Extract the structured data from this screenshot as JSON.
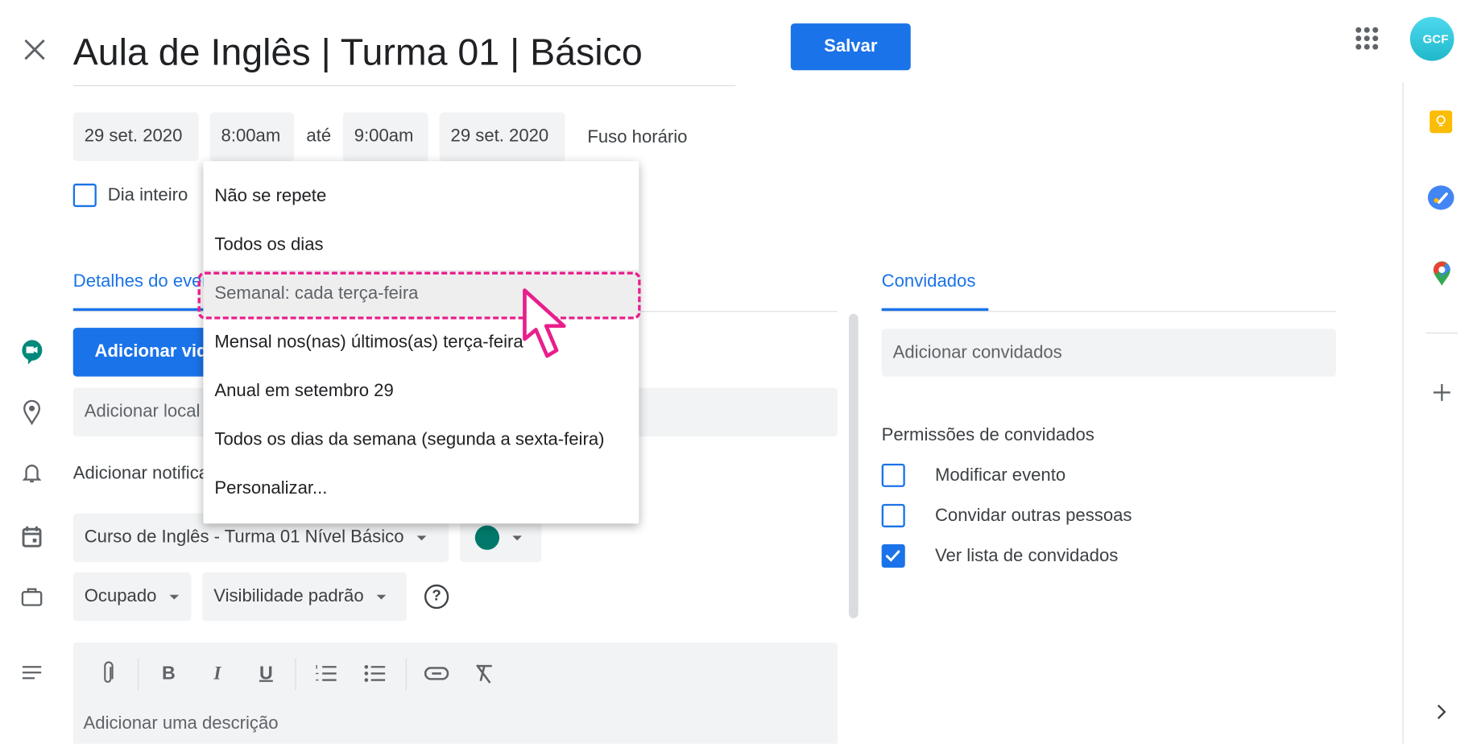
{
  "header": {
    "title": "Aula de Inglês | Turma 01 | Básico",
    "save_label": "Salvar",
    "avatar_text": "GCF"
  },
  "datetime": {
    "start_date": "29 set. 2020",
    "start_time": "8:00am",
    "until": "até",
    "end_time": "9:00am",
    "end_date": "29 set. 2020",
    "timezone": "Fuso horário",
    "all_day_label": "Dia inteiro",
    "all_day_checked": false
  },
  "recurrence_menu": {
    "items": [
      "Não se repete",
      "Todos os dias",
      "Semanal: cada terça-feira",
      "Mensal nos(nas) últimos(as) terça-feira",
      "Anual em setembro 29",
      "Todos os dias da semana (segunda a sexta-feira)",
      "Personalizar..."
    ],
    "highlighted_index": 2
  },
  "tabs": {
    "details": "Detalhes do evento",
    "guests": "Convidados"
  },
  "details": {
    "meet_button": "Adicionar videoconferência",
    "location_placeholder": "Adicionar local",
    "notification": "Adicionar notificação",
    "calendar": "Curso de Inglês - Turma 01 Nível Básico",
    "event_color": "#00796b",
    "availability": "Ocupado",
    "visibility": "Visibilidade padrão",
    "description_placeholder": "Adicionar uma descrição"
  },
  "guests": {
    "input_placeholder": "Adicionar convidados",
    "permissions_title": "Permissões de convidados",
    "permissions": [
      {
        "label": "Modificar evento",
        "checked": false
      },
      {
        "label": "Convidar outras pessoas",
        "checked": false
      },
      {
        "label": "Ver lista de convidados",
        "checked": true
      }
    ]
  },
  "colors": {
    "accent": "#1a73e8",
    "highlight": "#e91e8c"
  }
}
